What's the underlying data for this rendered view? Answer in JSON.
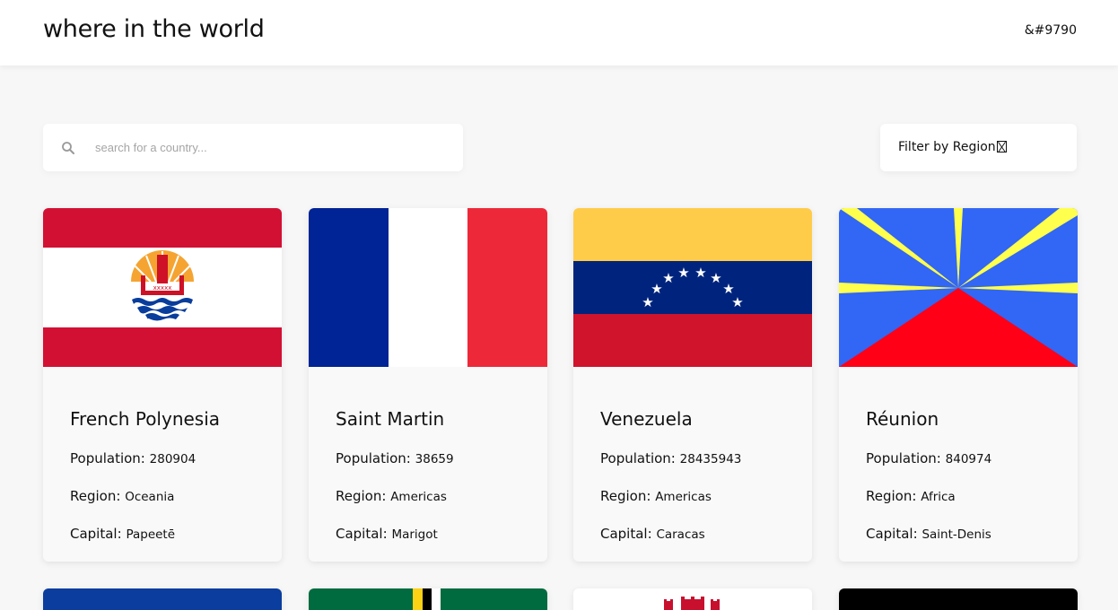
{
  "header": {
    "title": "where in the world",
    "mode_toggle": "&#9790"
  },
  "search": {
    "placeholder": "search for a country...",
    "icon": "search-icon"
  },
  "filter": {
    "label": "Filter by Region"
  },
  "labels": {
    "population": "Population:",
    "region": "Region:",
    "capital": "Capital:"
  },
  "countries": [
    {
      "name": "French Polynesia",
      "population": "280904",
      "region": "Oceania",
      "capital": "Papeetē"
    },
    {
      "name": "Saint Martin",
      "population": "38659",
      "region": "Americas",
      "capital": "Marigot"
    },
    {
      "name": "Venezuela",
      "population": "28435943",
      "region": "Americas",
      "capital": "Caracas"
    },
    {
      "name": "Réunion",
      "population": "840974",
      "region": "Africa",
      "capital": "Saint-Denis"
    }
  ],
  "colors": {
    "background": "#f7f7f7",
    "card": "#f9f9f9",
    "header": "#ffffff"
  }
}
